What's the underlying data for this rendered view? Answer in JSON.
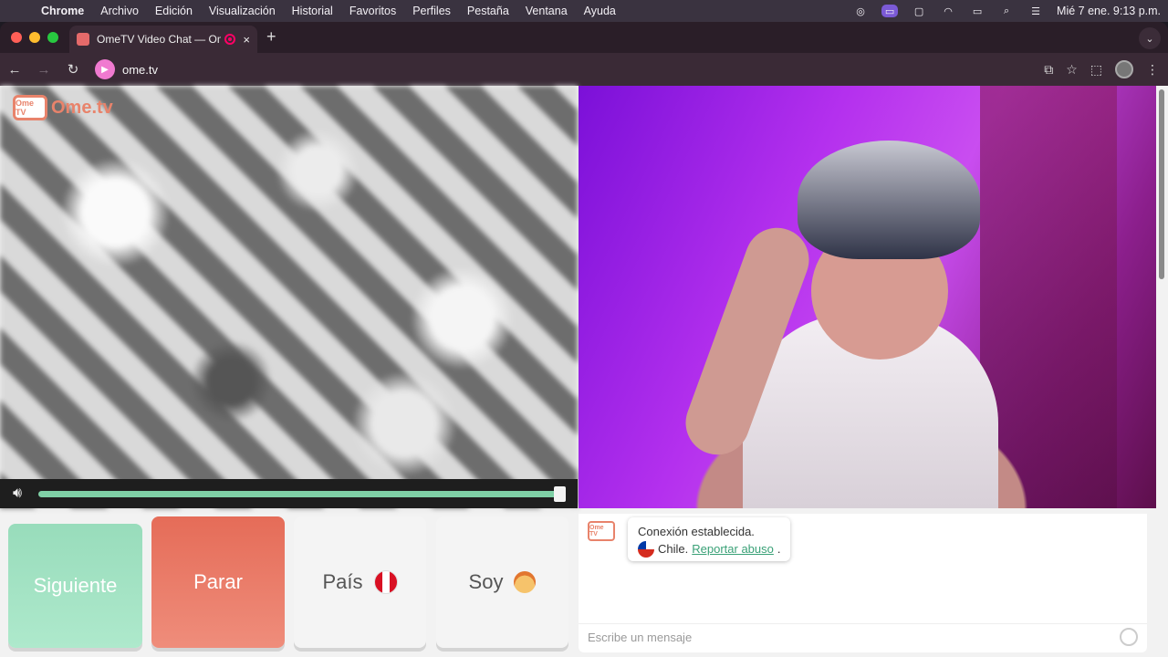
{
  "menubar": {
    "apple_icon": "apple-icon",
    "app_name": "Chrome",
    "menus": [
      "Archivo",
      "Edición",
      "Visualización",
      "Historial",
      "Favoritos",
      "Perfiles",
      "Pestaña",
      "Ventana",
      "Ayuda"
    ],
    "clock": "Mié 7 ene.  9:13 p.m."
  },
  "browser": {
    "tab_title": "OmeTV Video Chat — Ome",
    "tab_close": "×",
    "new_tab": "+",
    "url": "ome.tv"
  },
  "site": {
    "brand_tv": "Ome TV",
    "brand_word": "Ome.tv"
  },
  "controls": {
    "next_label": "Siguiente",
    "stop_label": "Parar",
    "country_label": "País",
    "me_label": "Soy",
    "volume_level": 0.98
  },
  "chat": {
    "logo": "Ome TV",
    "message_line1": "Conexión establecida.",
    "country_text": "Chile.",
    "report_link": "Reportar abuso",
    "report_suffix": ".",
    "input_placeholder": "Escribe un mensaje"
  },
  "colors": {
    "next_button": "#a8e4c6",
    "stop_button": "#ea7b67",
    "brand": "#e8836b",
    "link": "#3aa177"
  }
}
